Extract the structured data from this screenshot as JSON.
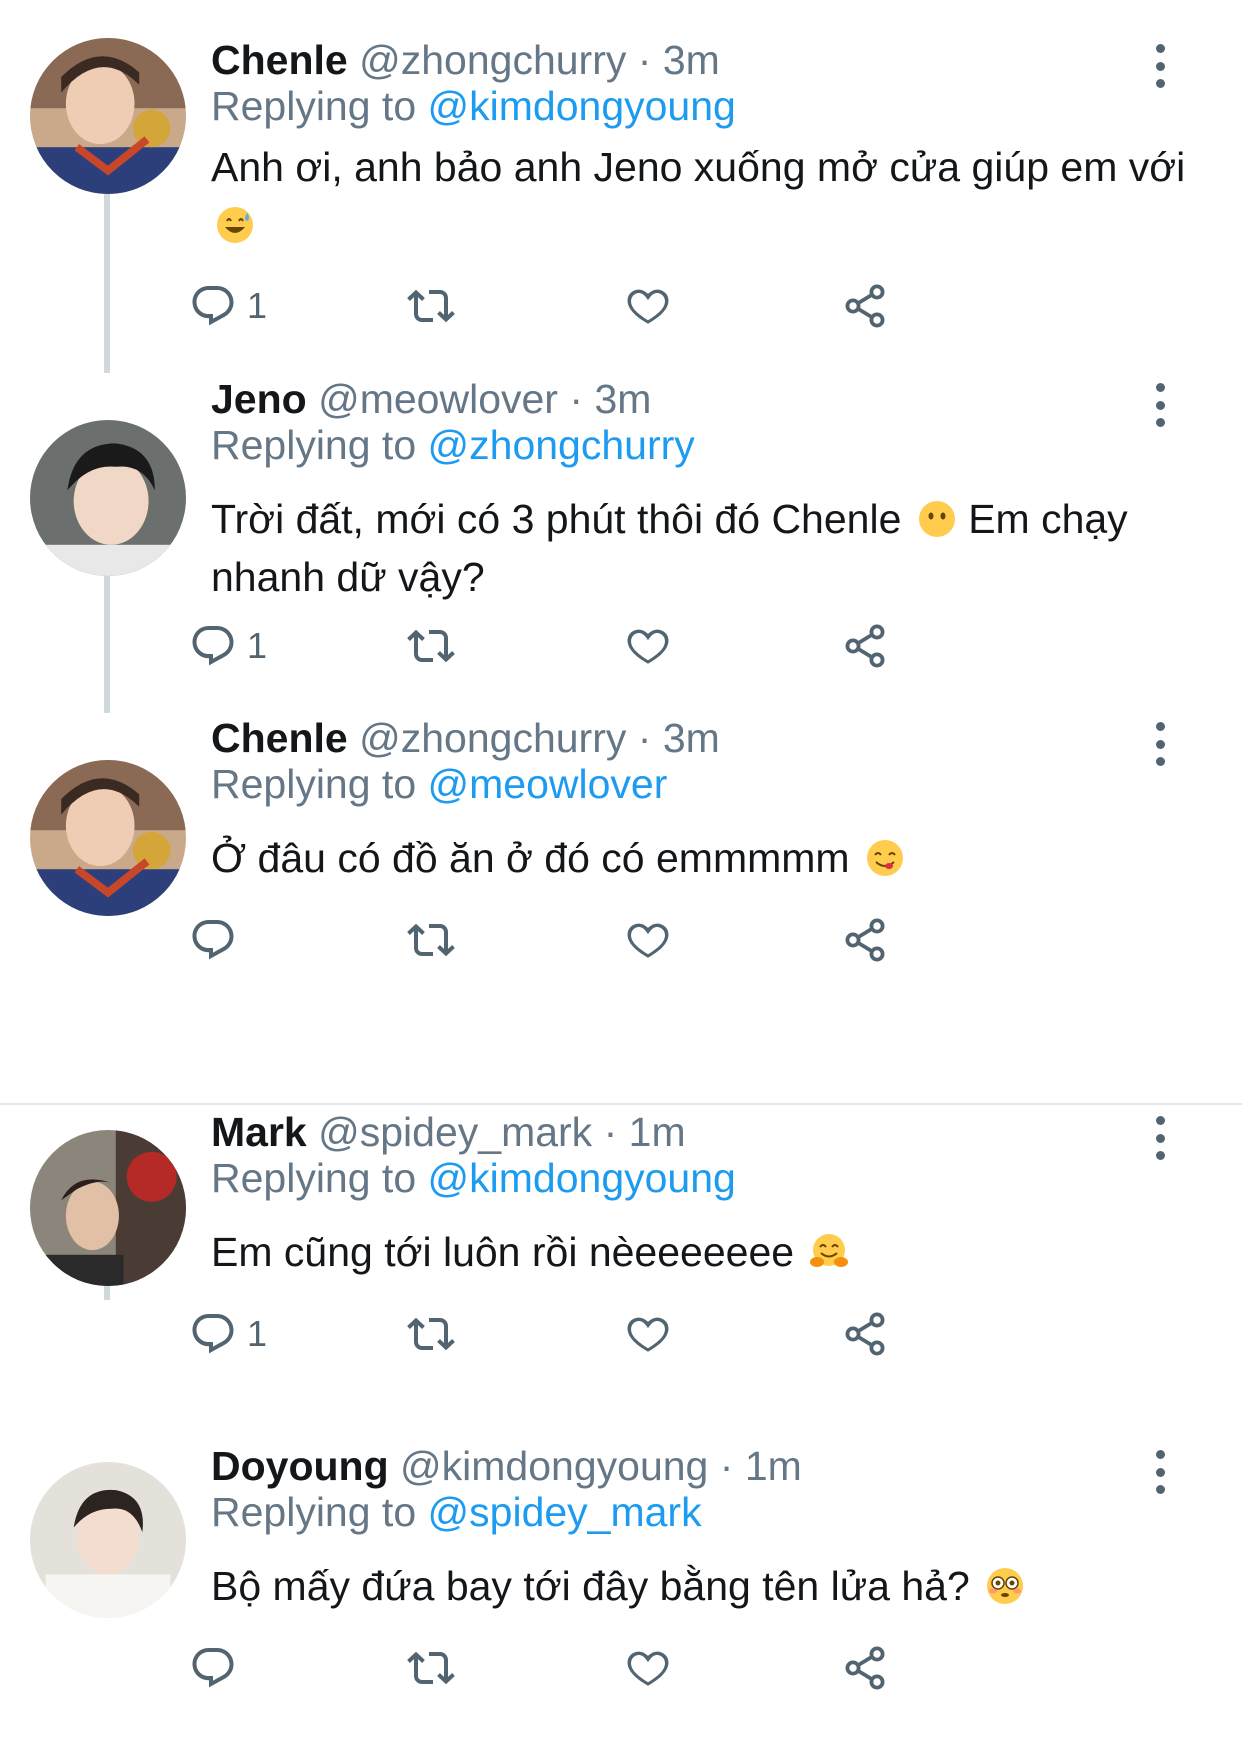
{
  "tweets": [
    {
      "name": "Chenle",
      "handle": "@zhongchurry",
      "time": "3m",
      "replying_prefix": "Replying to",
      "replying_to": "@kimdongyoung",
      "text": "Anh ơi, anh bảo anh Jeno xuống mở cửa giúp em với",
      "emoji": "sweat-smile-emoji",
      "reply_count": "1",
      "avatar": "chenle-avatar"
    },
    {
      "name": "Jeno",
      "handle": "@meowlover",
      "time": "3m",
      "replying_prefix": "Replying to",
      "replying_to": "@zhongchurry",
      "text": "Trời đất, mới có 3 phút thôi đó Chenle",
      "text_after": "Em chạy nhanh dữ vậy?",
      "emoji": "no-mouth-emoji",
      "reply_count": "1",
      "avatar": "jeno-avatar"
    },
    {
      "name": "Chenle",
      "handle": "@zhongchurry",
      "time": "3m",
      "replying_prefix": "Replying to",
      "replying_to": "@meowlover",
      "text": "Ở đâu có đồ ăn ở đó có emmmmm",
      "emoji": "yum-emoji",
      "reply_count": "",
      "avatar": "chenle-avatar"
    },
    {
      "name": "Mark",
      "handle": "@spidey_mark",
      "time": "1m",
      "replying_prefix": "Replying to",
      "replying_to": "@kimdongyoung",
      "text": "Em cũng tới luôn rồi nèeeeeeee",
      "emoji": "hugging-emoji",
      "reply_count": "1",
      "avatar": "mark-avatar"
    },
    {
      "name": "Doyoung",
      "handle": "@kimdongyoung",
      "time": "1m",
      "replying_prefix": "Replying to",
      "replying_to": "@spidey_mark",
      "text": "Bộ mấy đứa bay tới đây bằng tên lửa hả?",
      "emoji": "flushed-emoji",
      "reply_count": "",
      "avatar": "doyoung-avatar"
    }
  ],
  "separator": "·",
  "colors": {
    "link": "#1d9bf0",
    "muted": "#657786",
    "icon": "#536471",
    "thread": "#cfd9de"
  },
  "icons": [
    "reply-icon",
    "retweet-icon",
    "like-icon",
    "share-icon",
    "more-icon"
  ]
}
